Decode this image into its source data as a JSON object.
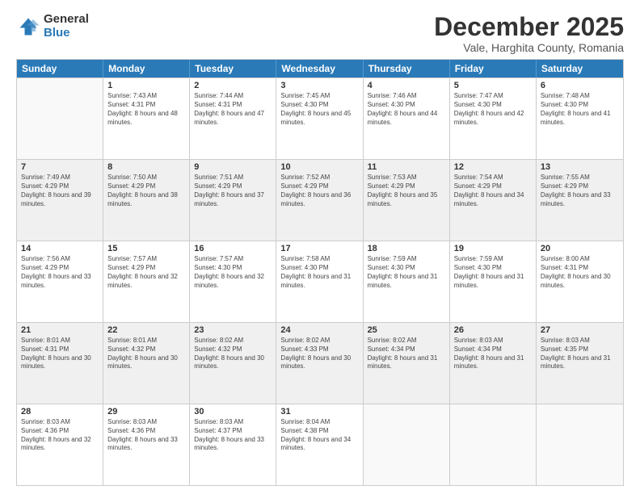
{
  "logo": {
    "general": "General",
    "blue": "Blue"
  },
  "title": "December 2025",
  "location": "Vale, Harghita County, Romania",
  "days_of_week": [
    "Sunday",
    "Monday",
    "Tuesday",
    "Wednesday",
    "Thursday",
    "Friday",
    "Saturday"
  ],
  "weeks": [
    [
      {
        "day": "",
        "sunrise": "",
        "sunset": "",
        "daylight": ""
      },
      {
        "day": "1",
        "sunrise": "Sunrise: 7:43 AM",
        "sunset": "Sunset: 4:31 PM",
        "daylight": "Daylight: 8 hours and 48 minutes."
      },
      {
        "day": "2",
        "sunrise": "Sunrise: 7:44 AM",
        "sunset": "Sunset: 4:31 PM",
        "daylight": "Daylight: 8 hours and 47 minutes."
      },
      {
        "day": "3",
        "sunrise": "Sunrise: 7:45 AM",
        "sunset": "Sunset: 4:30 PM",
        "daylight": "Daylight: 8 hours and 45 minutes."
      },
      {
        "day": "4",
        "sunrise": "Sunrise: 7:46 AM",
        "sunset": "Sunset: 4:30 PM",
        "daylight": "Daylight: 8 hours and 44 minutes."
      },
      {
        "day": "5",
        "sunrise": "Sunrise: 7:47 AM",
        "sunset": "Sunset: 4:30 PM",
        "daylight": "Daylight: 8 hours and 42 minutes."
      },
      {
        "day": "6",
        "sunrise": "Sunrise: 7:48 AM",
        "sunset": "Sunset: 4:30 PM",
        "daylight": "Daylight: 8 hours and 41 minutes."
      }
    ],
    [
      {
        "day": "7",
        "sunrise": "Sunrise: 7:49 AM",
        "sunset": "Sunset: 4:29 PM",
        "daylight": "Daylight: 8 hours and 39 minutes."
      },
      {
        "day": "8",
        "sunrise": "Sunrise: 7:50 AM",
        "sunset": "Sunset: 4:29 PM",
        "daylight": "Daylight: 8 hours and 38 minutes."
      },
      {
        "day": "9",
        "sunrise": "Sunrise: 7:51 AM",
        "sunset": "Sunset: 4:29 PM",
        "daylight": "Daylight: 8 hours and 37 minutes."
      },
      {
        "day": "10",
        "sunrise": "Sunrise: 7:52 AM",
        "sunset": "Sunset: 4:29 PM",
        "daylight": "Daylight: 8 hours and 36 minutes."
      },
      {
        "day": "11",
        "sunrise": "Sunrise: 7:53 AM",
        "sunset": "Sunset: 4:29 PM",
        "daylight": "Daylight: 8 hours and 35 minutes."
      },
      {
        "day": "12",
        "sunrise": "Sunrise: 7:54 AM",
        "sunset": "Sunset: 4:29 PM",
        "daylight": "Daylight: 8 hours and 34 minutes."
      },
      {
        "day": "13",
        "sunrise": "Sunrise: 7:55 AM",
        "sunset": "Sunset: 4:29 PM",
        "daylight": "Daylight: 8 hours and 33 minutes."
      }
    ],
    [
      {
        "day": "14",
        "sunrise": "Sunrise: 7:56 AM",
        "sunset": "Sunset: 4:29 PM",
        "daylight": "Daylight: 8 hours and 33 minutes."
      },
      {
        "day": "15",
        "sunrise": "Sunrise: 7:57 AM",
        "sunset": "Sunset: 4:29 PM",
        "daylight": "Daylight: 8 hours and 32 minutes."
      },
      {
        "day": "16",
        "sunrise": "Sunrise: 7:57 AM",
        "sunset": "Sunset: 4:30 PM",
        "daylight": "Daylight: 8 hours and 32 minutes."
      },
      {
        "day": "17",
        "sunrise": "Sunrise: 7:58 AM",
        "sunset": "Sunset: 4:30 PM",
        "daylight": "Daylight: 8 hours and 31 minutes."
      },
      {
        "day": "18",
        "sunrise": "Sunrise: 7:59 AM",
        "sunset": "Sunset: 4:30 PM",
        "daylight": "Daylight: 8 hours and 31 minutes."
      },
      {
        "day": "19",
        "sunrise": "Sunrise: 7:59 AM",
        "sunset": "Sunset: 4:30 PM",
        "daylight": "Daylight: 8 hours and 31 minutes."
      },
      {
        "day": "20",
        "sunrise": "Sunrise: 8:00 AM",
        "sunset": "Sunset: 4:31 PM",
        "daylight": "Daylight: 8 hours and 30 minutes."
      }
    ],
    [
      {
        "day": "21",
        "sunrise": "Sunrise: 8:01 AM",
        "sunset": "Sunset: 4:31 PM",
        "daylight": "Daylight: 8 hours and 30 minutes."
      },
      {
        "day": "22",
        "sunrise": "Sunrise: 8:01 AM",
        "sunset": "Sunset: 4:32 PM",
        "daylight": "Daylight: 8 hours and 30 minutes."
      },
      {
        "day": "23",
        "sunrise": "Sunrise: 8:02 AM",
        "sunset": "Sunset: 4:32 PM",
        "daylight": "Daylight: 8 hours and 30 minutes."
      },
      {
        "day": "24",
        "sunrise": "Sunrise: 8:02 AM",
        "sunset": "Sunset: 4:33 PM",
        "daylight": "Daylight: 8 hours and 30 minutes."
      },
      {
        "day": "25",
        "sunrise": "Sunrise: 8:02 AM",
        "sunset": "Sunset: 4:34 PM",
        "daylight": "Daylight: 8 hours and 31 minutes."
      },
      {
        "day": "26",
        "sunrise": "Sunrise: 8:03 AM",
        "sunset": "Sunset: 4:34 PM",
        "daylight": "Daylight: 8 hours and 31 minutes."
      },
      {
        "day": "27",
        "sunrise": "Sunrise: 8:03 AM",
        "sunset": "Sunset: 4:35 PM",
        "daylight": "Daylight: 8 hours and 31 minutes."
      }
    ],
    [
      {
        "day": "28",
        "sunrise": "Sunrise: 8:03 AM",
        "sunset": "Sunset: 4:36 PM",
        "daylight": "Daylight: 8 hours and 32 minutes."
      },
      {
        "day": "29",
        "sunrise": "Sunrise: 8:03 AM",
        "sunset": "Sunset: 4:36 PM",
        "daylight": "Daylight: 8 hours and 33 minutes."
      },
      {
        "day": "30",
        "sunrise": "Sunrise: 8:03 AM",
        "sunset": "Sunset: 4:37 PM",
        "daylight": "Daylight: 8 hours and 33 minutes."
      },
      {
        "day": "31",
        "sunrise": "Sunrise: 8:04 AM",
        "sunset": "Sunset: 4:38 PM",
        "daylight": "Daylight: 8 hours and 34 minutes."
      },
      {
        "day": "",
        "sunrise": "",
        "sunset": "",
        "daylight": ""
      },
      {
        "day": "",
        "sunrise": "",
        "sunset": "",
        "daylight": ""
      },
      {
        "day": "",
        "sunrise": "",
        "sunset": "",
        "daylight": ""
      }
    ]
  ]
}
